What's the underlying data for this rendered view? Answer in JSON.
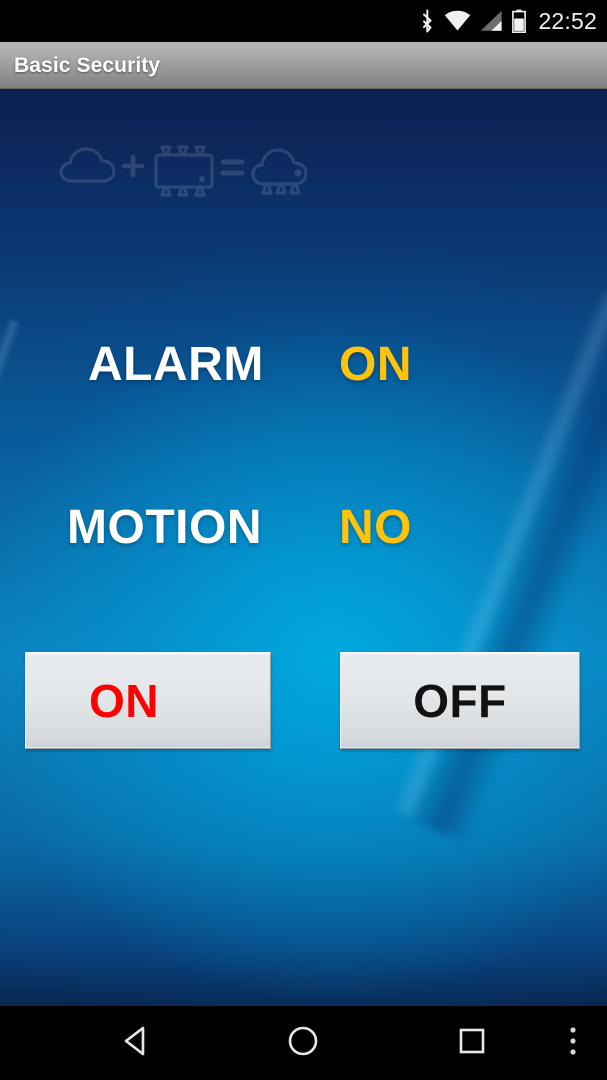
{
  "status_bar": {
    "clock": "22:52",
    "icons": [
      {
        "name": "bluetooth-icon",
        "label": "Bluetooth"
      },
      {
        "name": "wifi-icon",
        "label": "Wi-Fi"
      },
      {
        "name": "cellular-signal-icon",
        "label": "Cellular signal"
      },
      {
        "name": "battery-icon",
        "label": "Battery"
      }
    ],
    "background_color": "#000000",
    "text_color": "#f2f2f2"
  },
  "title_bar": {
    "title": "Basic Security",
    "text_color": "#ffffff",
    "background_color": "#a6a6a6"
  },
  "watermark": {
    "name": "cloud-plus-chip-equals-cloudchip-logo",
    "description": "cloud + chip = cloud-chip",
    "opacity": "0.13"
  },
  "main": {
    "background_colors": {
      "top": "#0c1f4f",
      "center": "#0e9fd4",
      "bottom": "#08264f"
    },
    "status_rows": [
      {
        "label": "ALARM",
        "value": "ON",
        "label_color": "#ffffff",
        "value_color": "#FFC20E"
      },
      {
        "label": "MOTION",
        "value": "NO",
        "label_color": "#ffffff",
        "value_color": "#FFC20E"
      }
    ],
    "buttons": [
      {
        "label": "ON",
        "text_color": "#FF0000",
        "background_color": "#e3e7e9"
      },
      {
        "label": "OFF",
        "text_color": "#111111",
        "background_color": "#e3e7e9"
      }
    ]
  },
  "nav_bar": {
    "background_color": "#000000",
    "buttons": [
      {
        "name": "back-icon",
        "label": "Back"
      },
      {
        "name": "home-icon",
        "label": "Home"
      },
      {
        "name": "recents-icon",
        "label": "Recent apps"
      },
      {
        "name": "overflow-menu-icon",
        "label": "More options"
      }
    ]
  }
}
